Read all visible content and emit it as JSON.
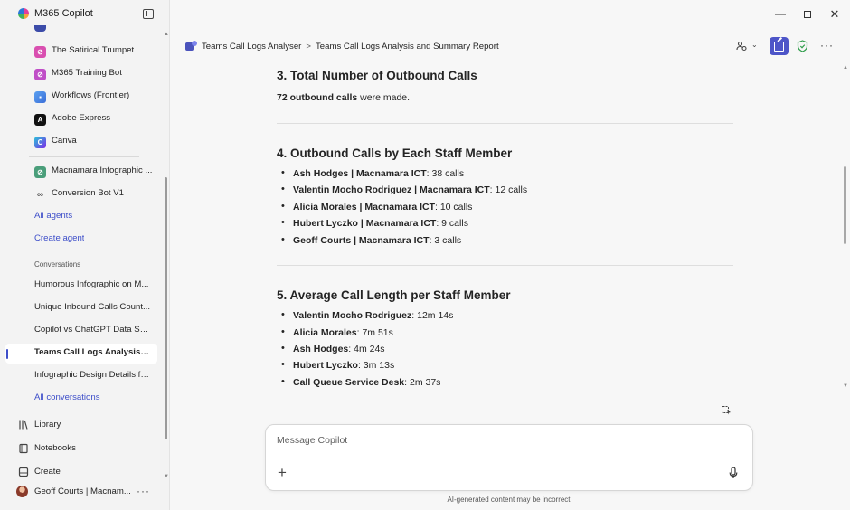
{
  "app": {
    "title": "M365 Copilot"
  },
  "sidebar": {
    "agents": [
      {
        "label": "The Satirical Trumpet",
        "icon": "satirical-trumpet-icon",
        "color": "#d94fb0"
      },
      {
        "label": "M365 Training Bot",
        "icon": "training-bot-icon",
        "color": "#c04ec7"
      },
      {
        "label": "Workflows (Frontier)",
        "icon": "workflows-icon",
        "color": "#3b6fd8"
      },
      {
        "label": "Adobe Express",
        "icon": "adobe-express-icon",
        "color": "#111111"
      },
      {
        "label": "Canva",
        "icon": "canva-icon",
        "color": "#2aa5d8"
      },
      {
        "label": "Macnamara Infographic ...",
        "icon": "infographic-agent-icon",
        "color": "#4a9e7a"
      },
      {
        "label": "Conversion Bot V1",
        "icon": "conversion-bot-icon",
        "color": "#555555"
      }
    ],
    "all_agents": "All agents",
    "create_agent": "Create agent",
    "conversations_label": "Conversations",
    "conversations": [
      {
        "label": "Humorous Infographic on M..."
      },
      {
        "label": "Unique Inbound Calls Count..."
      },
      {
        "label": "Copilot vs ChatGPT Data Sec..."
      },
      {
        "label": "Teams Call Logs Analysis an...",
        "active": true
      },
      {
        "label": "Infographic Design Details fo..."
      }
    ],
    "all_conversations": "All conversations",
    "bottom": [
      {
        "label": "Library",
        "icon": "library-icon"
      },
      {
        "label": "Notebooks",
        "icon": "notebook-icon"
      },
      {
        "label": "Create",
        "icon": "create-icon"
      }
    ],
    "user": {
      "name": "Geoff Courts | Macnam...",
      "more": "···"
    }
  },
  "header": {
    "breadcrumb_agent": "Teams Call Logs Analyser",
    "breadcrumb_sep": ">",
    "breadcrumb_title": "Teams Call Logs Analysis and Summary Report"
  },
  "report": {
    "section3": {
      "heading": "3. Total Number of Outbound Calls",
      "bold": "72 outbound calls",
      "rest": " were made."
    },
    "section4": {
      "heading": "4. Outbound Calls by Each Staff Member",
      "items": [
        {
          "name": "Ash Hodges | Macnamara ICT",
          "value": ": 38 calls"
        },
        {
          "name": "Valentin Mocho Rodriguez | Macnamara ICT",
          "value": ": 12 calls"
        },
        {
          "name": "Alicia Morales | Macnamara ICT",
          "value": ": 10 calls"
        },
        {
          "name": "Hubert Lyczko | Macnamara ICT",
          "value": ": 9 calls"
        },
        {
          "name": "Geoff Courts | Macnamara ICT",
          "value": ": 3 calls"
        }
      ]
    },
    "section5": {
      "heading": "5. Average Call Length per Staff Member",
      "items": [
        {
          "name": "Valentin Mocho Rodriguez",
          "value": ": 12m 14s"
        },
        {
          "name": "Alicia Morales",
          "value": ": 7m 51s"
        },
        {
          "name": "Ash Hodges",
          "value": ": 4m 24s"
        },
        {
          "name": "Hubert Lyczko",
          "value": ": 3m 13s"
        },
        {
          "name": "Call Queue Service Desk",
          "value": ": 2m 37s"
        }
      ]
    }
  },
  "composer": {
    "placeholder": "Message Copilot",
    "disclaimer": "AI-generated content may be incorrect"
  },
  "colors": {
    "accent": "#4d55c8",
    "link": "#3d4ec9"
  }
}
